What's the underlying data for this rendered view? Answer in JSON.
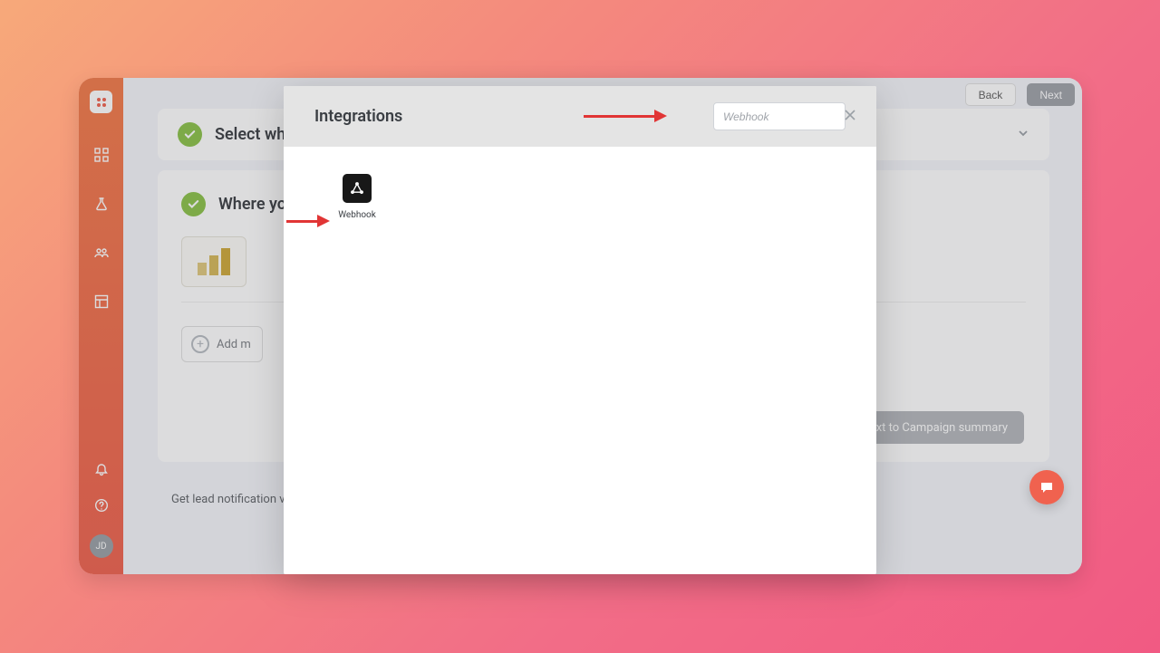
{
  "topbar": {
    "back_label": "Back",
    "next_label": "Next"
  },
  "sidebar": {
    "avatar_initials": "JD"
  },
  "sections": {
    "select_label": "Select wh",
    "where_label": "Where yo",
    "add_more_label": "Add m",
    "cta_label": "ext to Campaign summary",
    "notification_text": "Get lead notification via"
  },
  "modal": {
    "title": "Integrations",
    "search_value": "Webhook",
    "integration_items": [
      {
        "name": "Webhook",
        "icon": "webhook-icon"
      }
    ]
  },
  "colors": {
    "brand": "#f0624f",
    "success": "#8bc34a",
    "arrow": "#e13535"
  }
}
